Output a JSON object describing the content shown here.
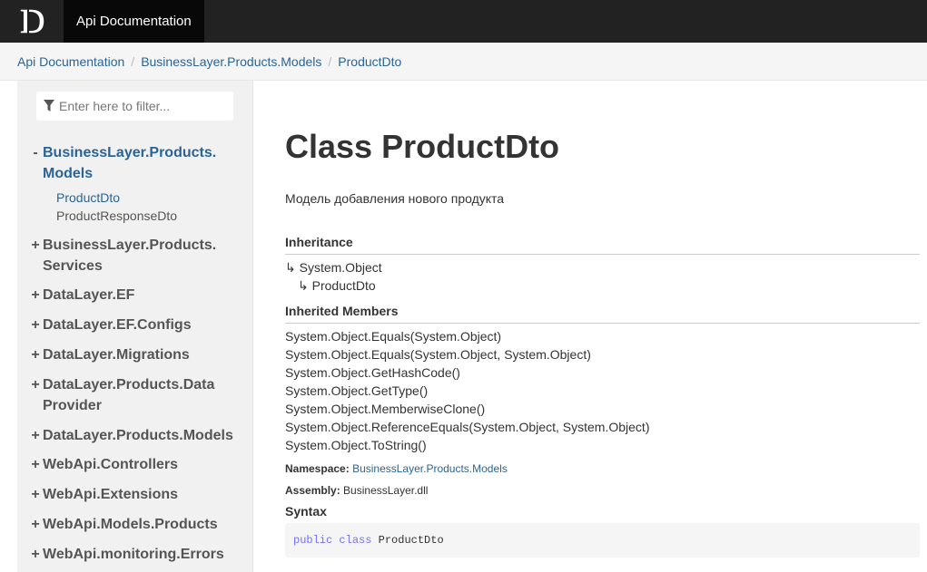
{
  "header": {
    "logo_alt": "D",
    "brand": "Api Documentation"
  },
  "breadcrumb": [
    "Api Documentation",
    "BusinessLayer.Products.Models",
    "ProductDto"
  ],
  "sidebar": {
    "filter_placeholder": "Enter here to filter...",
    "namespaces": [
      {
        "toggle": "-",
        "label": "BusinessLayer.Products.Models",
        "line1": "BusinessLayer.Products.",
        "line2": "Models",
        "expanded": true,
        "children": [
          {
            "label": "ProductDto",
            "active": true
          },
          {
            "label": "ProductResponseDto",
            "active": false
          }
        ]
      },
      {
        "toggle": "+",
        "line1": "BusinessLayer.Products.",
        "line2": "Services"
      },
      {
        "toggle": "+",
        "line1": "DataLayer.EF"
      },
      {
        "toggle": "+",
        "line1": "DataLayer.EF.Configs"
      },
      {
        "toggle": "+",
        "line1": "DataLayer.Migrations"
      },
      {
        "toggle": "+",
        "line1": "DataLayer.Products.Data",
        "line2": "Provider"
      },
      {
        "toggle": "+",
        "line1": "DataLayer.Products.Models"
      },
      {
        "toggle": "+",
        "line1": "WebApi.Controllers"
      },
      {
        "toggle": "+",
        "line1": "WebApi.Extensions"
      },
      {
        "toggle": "+",
        "line1": "WebApi.Models.Products"
      },
      {
        "toggle": "+",
        "line1": "WebApi.monitoring.Errors"
      }
    ]
  },
  "main": {
    "title": "Class ProductDto",
    "summary": "Модель добавления нового продукта",
    "inheritance_heading": "Inheritance",
    "inheritance": [
      "↳ System.Object",
      "↳ ProductDto"
    ],
    "inherited_members_heading": "Inherited Members",
    "inherited_members": [
      "System.Object.Equals(System.Object)",
      "System.Object.Equals(System.Object, System.Object)",
      "System.Object.GetHashCode()",
      "System.Object.GetType()",
      "System.Object.MemberwiseClone()",
      "System.Object.ReferenceEquals(System.Object, System.Object)",
      "System.Object.ToString()"
    ],
    "namespace_label": "Namespace:",
    "namespace_value": "BusinessLayer.Products.Models",
    "assembly_label": "Assembly:",
    "assembly_value": "BusinessLayer.dll",
    "syntax_heading": "Syntax",
    "code": {
      "kw1": "public",
      "kw2": "class",
      "name": "ProductDto"
    }
  },
  "colors": {
    "link": "#2a6496",
    "topbar": "#222222"
  }
}
